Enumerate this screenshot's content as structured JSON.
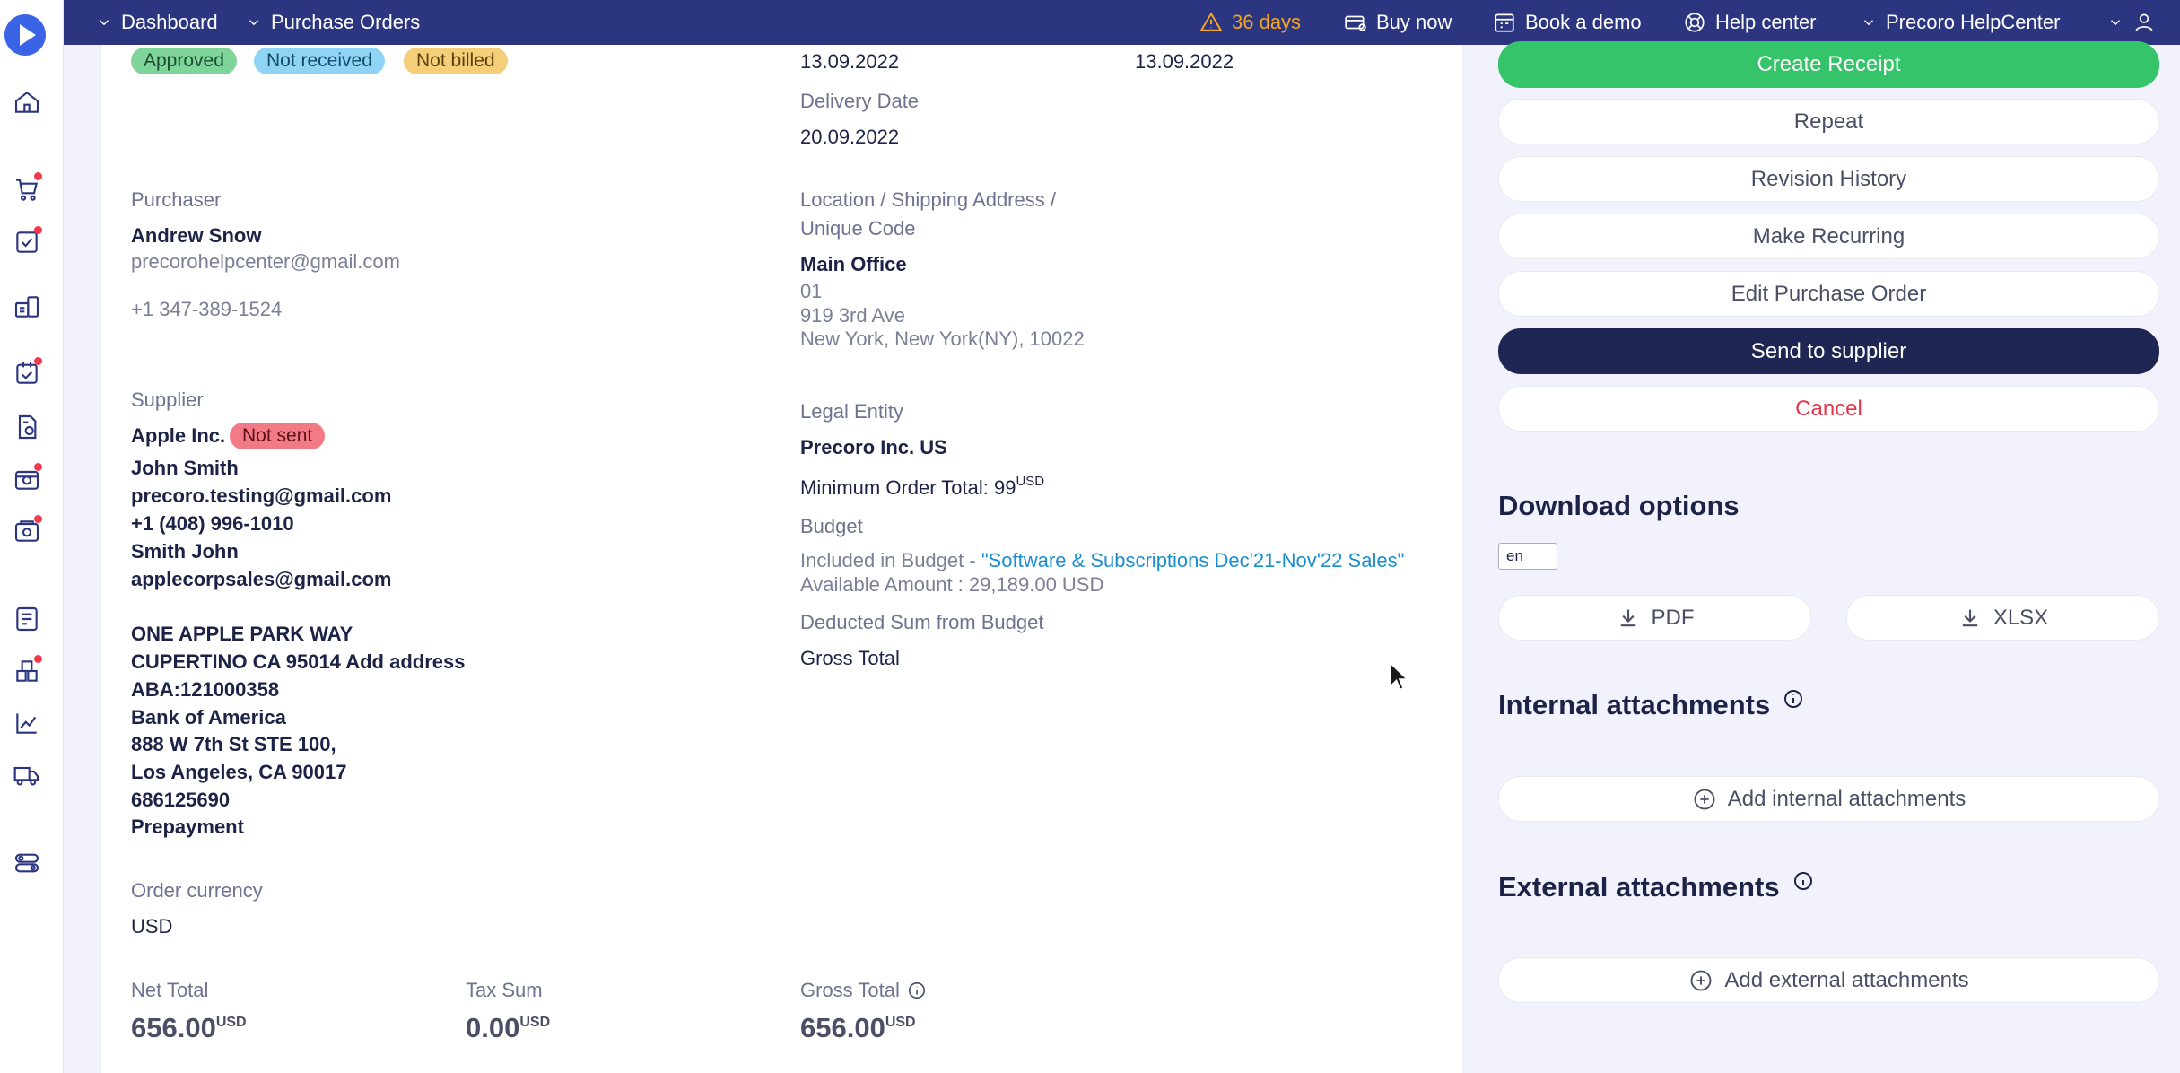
{
  "topbar": {
    "dashboard": "Dashboard",
    "purchase_orders": "Purchase Orders",
    "trial_days": "36 days",
    "buy_now": "Buy now",
    "book_demo": "Book a demo",
    "help_center": "Help center",
    "company": "Precoro HelpCenter"
  },
  "badges": {
    "approved": "Approved",
    "not_received": "Not received",
    "not_billed": "Not billed"
  },
  "dates": {
    "date_1": "13.09.2022",
    "date_2": "13.09.2022",
    "delivery_label": "Delivery Date",
    "delivery_value": "20.09.2022"
  },
  "purchaser": {
    "label": "Purchaser",
    "name": "Andrew Snow",
    "email": "precorohelpcenter@gmail.com",
    "phone": "+1 347-389-1524"
  },
  "location": {
    "label_line1": "Location / Shipping Address /",
    "label_line2": "Unique Code",
    "name": "Main Office",
    "code": "01",
    "street": "919 3rd Ave",
    "city": "New York, New York(NY), 10022"
  },
  "supplier": {
    "label": "Supplier",
    "name": "Apple Inc.",
    "status": "Not sent",
    "lines": [
      "John Smith",
      "precoro.testing@gmail.com",
      "+1 (408) 996-1010",
      "Smith John",
      "applecorpsales@gmail.com"
    ],
    "address_lines": [
      "ONE APPLE PARK WAY",
      "CUPERTINO CA 95014 Add address",
      "ABA:121000358",
      "Bank of America",
      "888 W 7th St STE 100,",
      "Los Angeles, CA 90017",
      "686125690",
      "Prepayment"
    ]
  },
  "legal_entity": {
    "label": "Legal Entity",
    "name": "Precoro Inc. US",
    "min_order_label": "Minimum Order Total: 99",
    "min_order_currency": "USD"
  },
  "budget": {
    "label": "Budget",
    "included_prefix": "Included in Budget - ",
    "budget_name": "\"Software & Subscriptions Dec'21-Nov'22 Sales\"",
    "available": "Available Amount : 29,189.00 USD",
    "deducted_label": "Deducted Sum from Budget",
    "deducted_value": "Gross Total"
  },
  "currency": {
    "label": "Order currency",
    "value": "USD"
  },
  "totals": {
    "net_label": "Net Total",
    "net_value": "656.00",
    "tax_label": "Tax Sum",
    "tax_value": "0.00",
    "gross_label": "Gross Total",
    "gross_value": "656.00",
    "currency": "USD"
  },
  "actions": {
    "create_receipt": "Create Receipt",
    "repeat": "Repeat",
    "revision_history": "Revision History",
    "make_recurring": "Make Recurring",
    "edit_po": "Edit Purchase Order",
    "send_supplier": "Send to supplier",
    "cancel": "Cancel"
  },
  "downloads": {
    "title": "Download options",
    "lang": "en",
    "pdf": "PDF",
    "xlsx": "XLSX"
  },
  "attachments": {
    "internal_title": "Internal attachments",
    "add_internal": "Add internal attachments",
    "external_title": "External attachments",
    "add_external": "Add external attachments"
  },
  "colors": {
    "topbar": "#2b3580",
    "primary_green": "#35c46a",
    "navy": "#1f2654",
    "danger": "#e5344a",
    "approved_badge": "#7fd49a",
    "not_received_badge": "#8fd3f5",
    "not_billed_badge": "#f5ce7a",
    "not_sent_badge": "#f17a84",
    "link": "#1a8fcf"
  }
}
